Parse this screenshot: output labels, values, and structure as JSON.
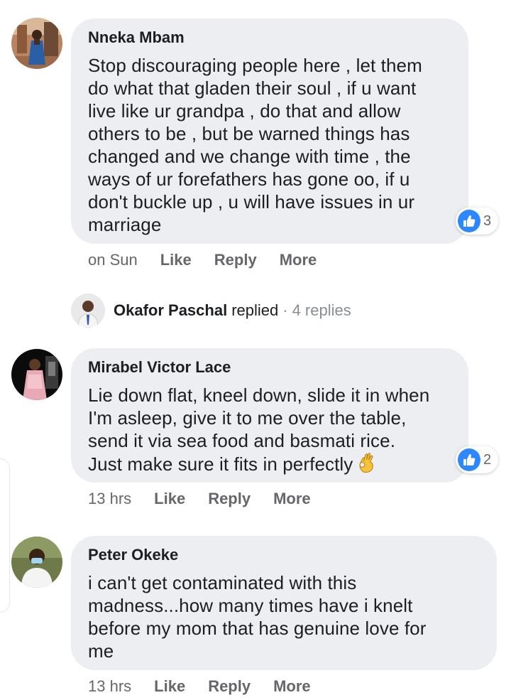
{
  "comments": [
    {
      "author": "Nneka Mbam",
      "text": "Stop discouraging people here , let them\ndo what that gladen their soul , if u want\nlive like ur grandpa , do that and allow\nothers to be , but be warned things has\nchanged and we change with time , the\nways of ur forefathers has gone oo, if u\ndon't buckle up , u will have issues in ur\nmarriage",
      "reactions": "3",
      "time": "on Sun",
      "like": "Like",
      "reply": "Reply",
      "more": "More"
    },
    {
      "author": "Mirabel Victor Lace",
      "text": "Lie down flat, kneel down, slide it in when\nI'm asleep, give it to me over the table,\nsend it via sea food and basmati rice.\nJust make sure it fits in perfectly",
      "reactions": "2",
      "time": "13 hrs",
      "like": "Like",
      "reply": "Reply",
      "more": "More"
    },
    {
      "author": "Peter Okeke",
      "text": "i can't get contaminated with this\nmadness...how many times have i knelt\nbefore my mom that has genuine love for\nme",
      "time": "13 hrs",
      "like": "Like",
      "reply": "Reply",
      "more": "More"
    }
  ],
  "replied": {
    "name": "Okafor Paschal",
    "verb": "replied",
    "separator": "·",
    "count": "4 replies"
  },
  "icons": {
    "reaction": "thumbs-up-icon",
    "emoji": "ok-hand-emoji-icon"
  },
  "colors": {
    "bubble": "#eceef2",
    "like_blue": "#2d88ff",
    "meta_gray": "#65676b"
  }
}
